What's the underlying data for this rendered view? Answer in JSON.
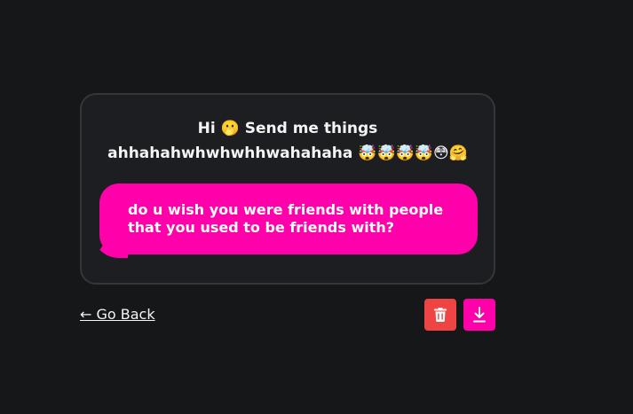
{
  "card": {
    "title": "Hi 🫢 Send me things ahhahahwhwhwhhwahahaha 🤯🤯🤯🤯😳🤗"
  },
  "message": {
    "text": "do u wish you were friends with people that you used to be friends with?"
  },
  "nav": {
    "go_back_label": "← Go Back"
  },
  "actions": {
    "delete_icon": "trash-icon",
    "download_icon": "download-icon"
  },
  "colors": {
    "background": "#161719",
    "card": "#1d1e21",
    "accent_pink": "#ff00aa",
    "delete_red": "#ef4444"
  }
}
